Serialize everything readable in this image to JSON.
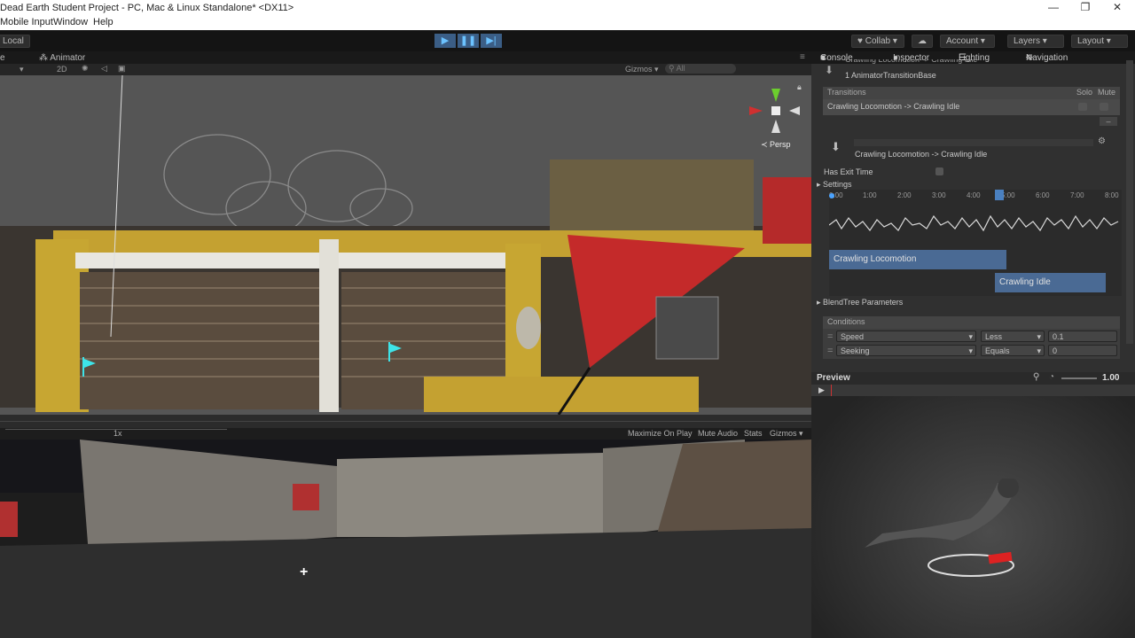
{
  "window": {
    "title": "Dead Earth Student Project - PC, Mac & Linux Standalone* <DX11>",
    "minimize": "—",
    "maximize": "❐",
    "close": "✕"
  },
  "menu": [
    "Mobile Input",
    "Window",
    "Help"
  ],
  "toolbar": {
    "local": "Local",
    "collab": "Collab",
    "account": "Account",
    "layers": "Layers",
    "layout": "Layout"
  },
  "scene": {
    "tab_animator": "Animator",
    "mode_2d": "2D",
    "gizmos": "Gizmos",
    "search_placeholder": "All",
    "persp_label": "Persp"
  },
  "game": {
    "scale": "1x",
    "maximize_on_play": "Maximize On Play",
    "mute_audio": "Mute Audio",
    "stats": "Stats",
    "gizmos": "Gizmos"
  },
  "inspector": {
    "tabs": [
      "Console",
      "Inspector",
      "Lighting",
      "Navigation"
    ],
    "header_truncated": "Crawling Locomotion -> Crawling Idle",
    "transition_base": "1 AnimatorTransitionBase",
    "transitions_label": "Transitions",
    "solo_label": "Solo",
    "mute_label": "Mute",
    "transition_row": "Crawling Locomotion -> Crawling Idle",
    "transition_title": "Crawling Locomotion -> Crawling Idle",
    "has_exit_time": "Has Exit Time",
    "settings": "Settings",
    "timeline_ticks": [
      "0:00",
      "1:00",
      "2:00",
      "3:00",
      "4:00",
      "5:00",
      "6:00",
      "7:00",
      "8:00"
    ],
    "clip_from": "Crawling Locomotion",
    "clip_to": "Crawling Idle",
    "blendtree_params": "BlendTree Parameters",
    "conditions_label": "Conditions",
    "conditions": [
      {
        "param": "Speed",
        "op": "Less",
        "value": "0.1"
      },
      {
        "param": "Seeking",
        "op": "Equals",
        "value": "0"
      }
    ]
  },
  "preview": {
    "label": "Preview",
    "speed": "1.00"
  },
  "colors": {
    "accent_blue": "#3b5e86",
    "clip_bar": "#4a6a94",
    "play_icon": "#6cc3ff"
  }
}
